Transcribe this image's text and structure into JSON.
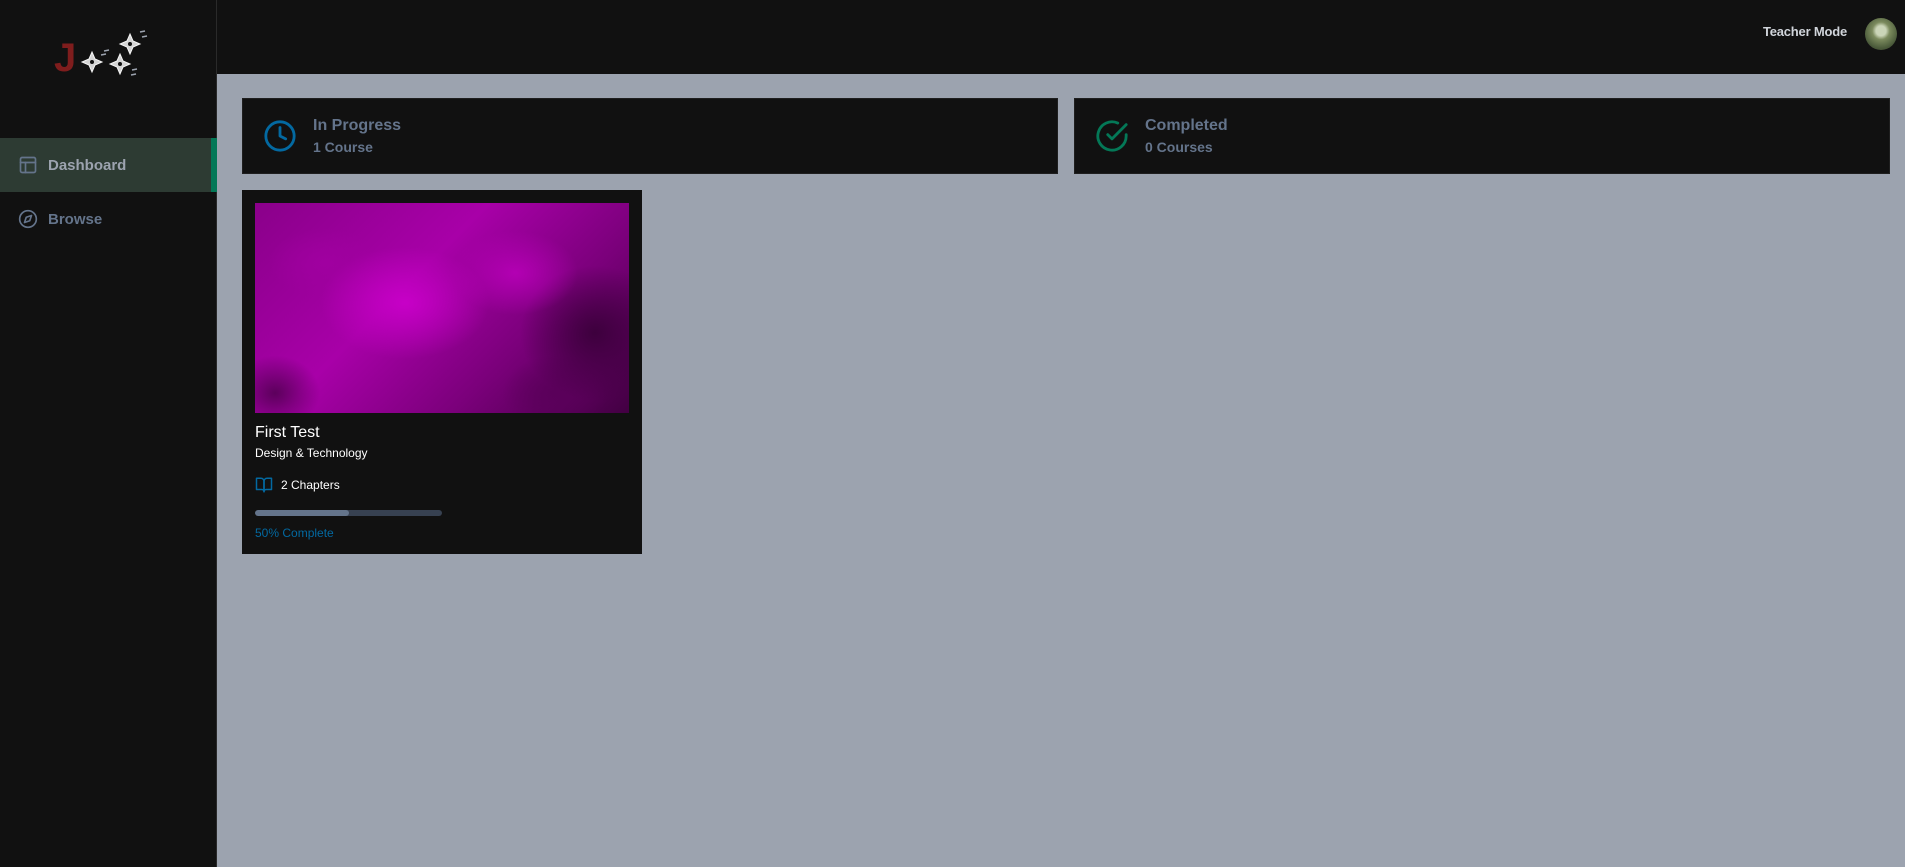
{
  "sidebar": {
    "logo_letter": "J",
    "items": [
      {
        "label": "Dashboard",
        "icon": "layout-icon",
        "active": true
      },
      {
        "label": "Browse",
        "icon": "compass-icon",
        "active": false
      }
    ]
  },
  "header": {
    "teacher_mode_label": "Teacher Mode"
  },
  "stats": {
    "in_progress": {
      "title": "In Progress",
      "count": "1 Course",
      "icon": "clock-icon",
      "color": "#0369a1"
    },
    "completed": {
      "title": "Completed",
      "count": "0 Courses",
      "icon": "check-circle-icon",
      "color": "#047857"
    }
  },
  "courses": [
    {
      "title": "First Test",
      "category": "Design & Technology",
      "chapters": "2 Chapters",
      "progress_label": "50% Complete",
      "progress_fraction": 0.5
    }
  ],
  "colors": {
    "accent_active": "#047857",
    "progress_text": "#0369a1",
    "background": "#9ca3af",
    "panel": "#111111"
  }
}
